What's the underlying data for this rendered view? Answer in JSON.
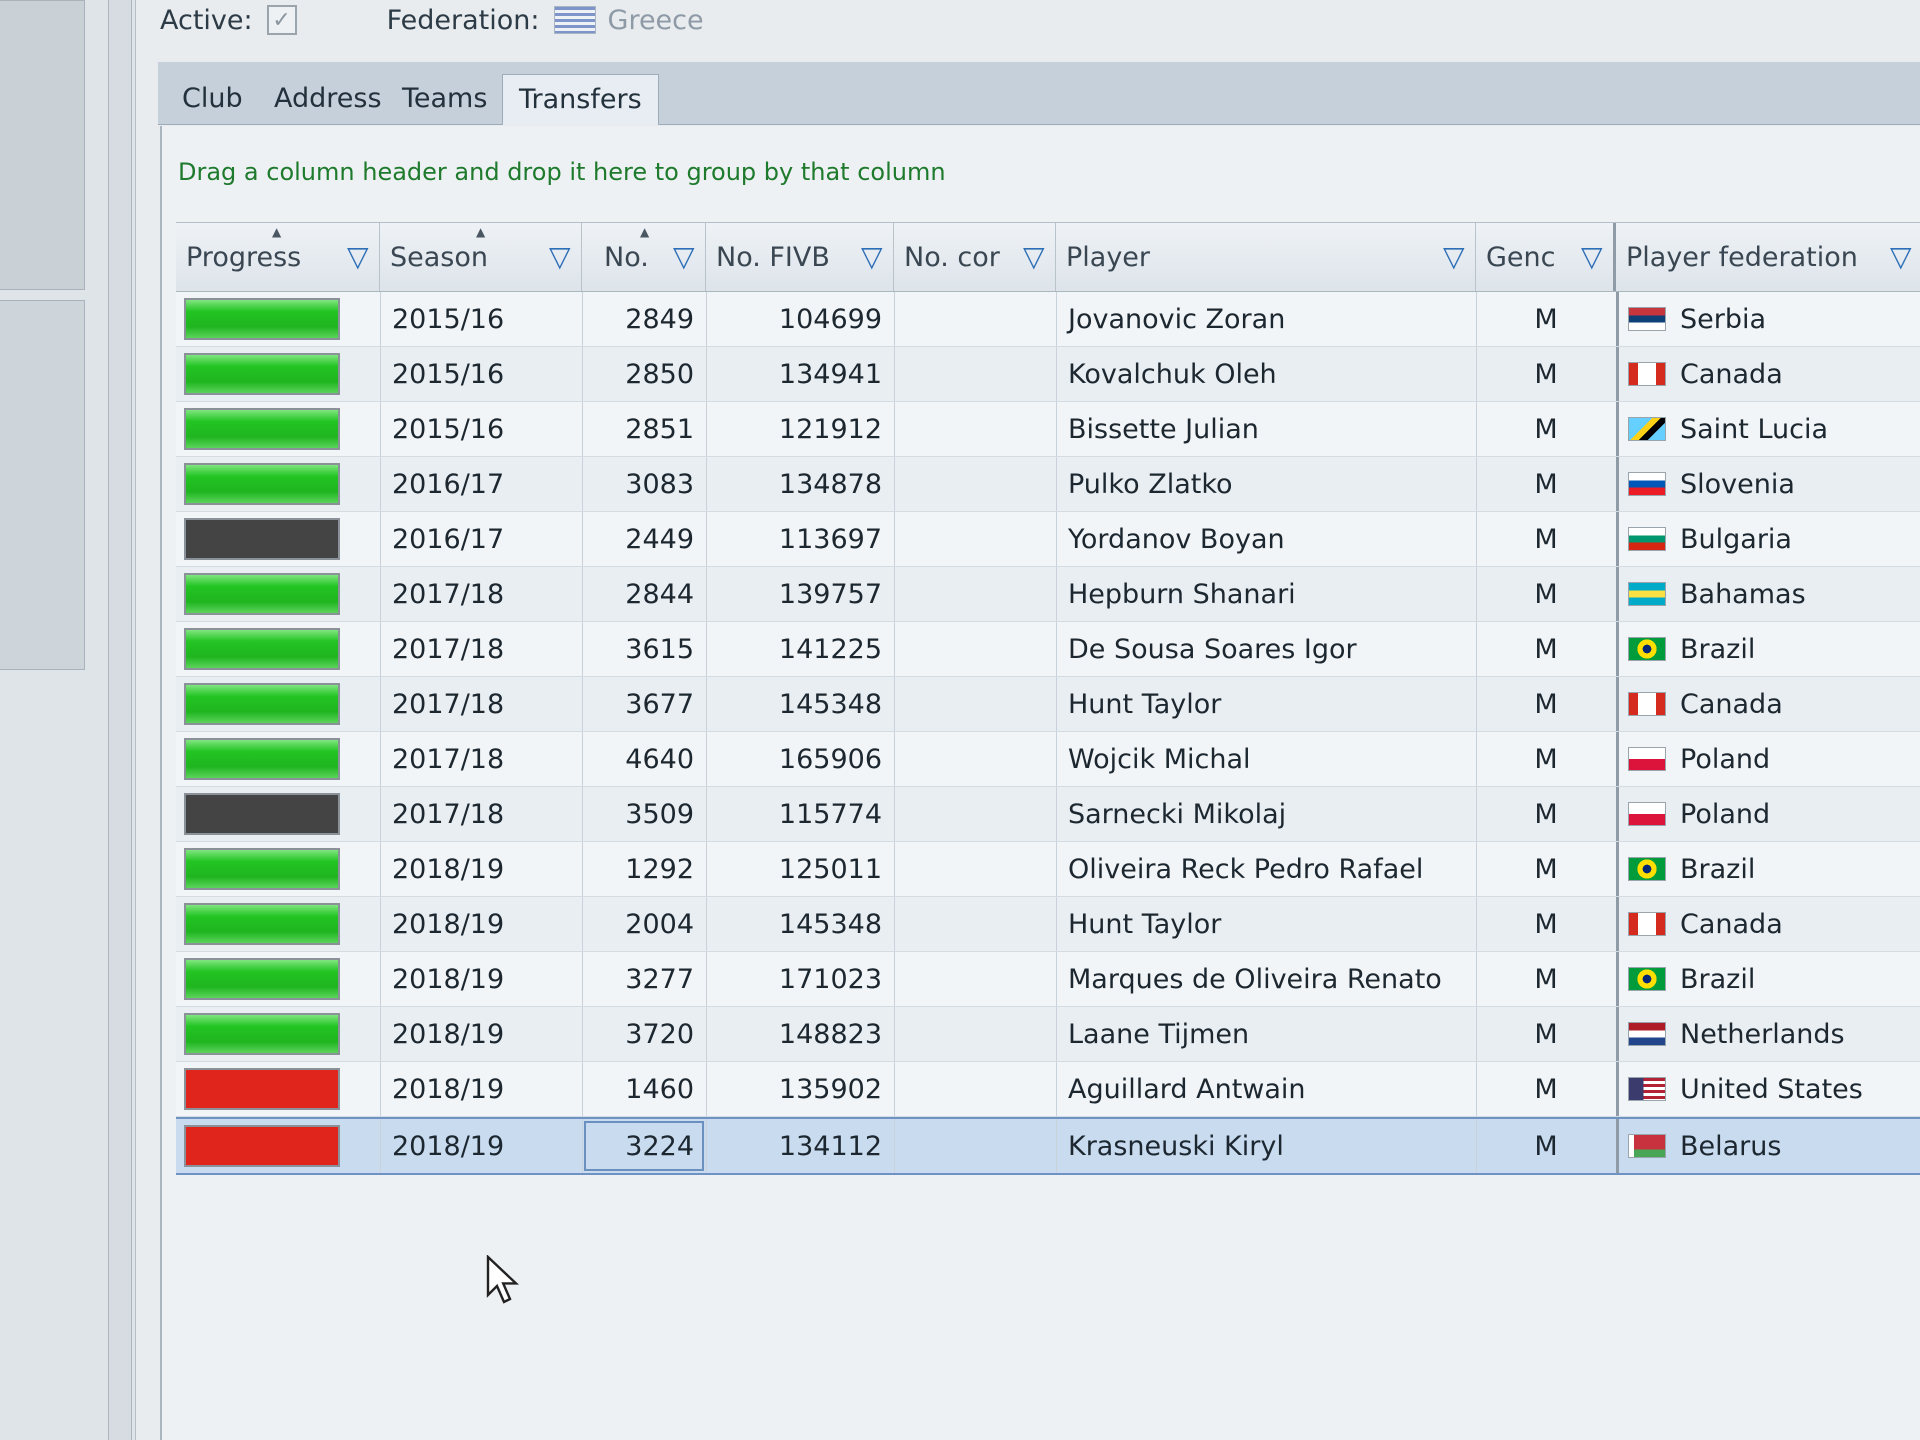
{
  "form": {
    "active_label": "Active:",
    "active_check": "✓",
    "federation_label": "Federation:",
    "federation_value": "Greece"
  },
  "tabs": [
    {
      "label": "Club"
    },
    {
      "label": "Address"
    },
    {
      "label": "Teams"
    },
    {
      "label": "Transfers"
    }
  ],
  "group_hint": "Drag a column header and drop it here to group by that column",
  "columns": {
    "progress": "Progress",
    "season": "Season",
    "no": "No.",
    "no_fivb": "No. FIVB",
    "no_con": "No. cor",
    "player": "Player",
    "gender": "Genc",
    "player_federation": "Player federation"
  },
  "filter_glyph": "▽",
  "rows": [
    {
      "progress": "green",
      "season": "2015/16",
      "no": "2849",
      "fivb": "104699",
      "player": "Jovanovic Zoran",
      "gender": "M",
      "federation": "Serbia",
      "flag": "serbia"
    },
    {
      "progress": "green",
      "season": "2015/16",
      "no": "2850",
      "fivb": "134941",
      "player": "Kovalchuk Oleh",
      "gender": "M",
      "federation": "Canada",
      "flag": "canada"
    },
    {
      "progress": "green",
      "season": "2015/16",
      "no": "2851",
      "fivb": "121912",
      "player": "Bissette Julian",
      "gender": "M",
      "federation": "Saint Lucia",
      "flag": "saint-lucia"
    },
    {
      "progress": "green",
      "season": "2016/17",
      "no": "3083",
      "fivb": "134878",
      "player": "Pulko Zlatko",
      "gender": "M",
      "federation": "Slovenia",
      "flag": "slovenia"
    },
    {
      "progress": "dark",
      "season": "2016/17",
      "no": "2449",
      "fivb": "113697",
      "player": "Yordanov Boyan",
      "gender": "M",
      "federation": "Bulgaria",
      "flag": "bulgaria"
    },
    {
      "progress": "green",
      "season": "2017/18",
      "no": "2844",
      "fivb": "139757",
      "player": "Hepburn Shanari",
      "gender": "M",
      "federation": "Bahamas",
      "flag": "bahamas"
    },
    {
      "progress": "green",
      "season": "2017/18",
      "no": "3615",
      "fivb": "141225",
      "player": "De Sousa Soares Igor",
      "gender": "M",
      "federation": "Brazil",
      "flag": "brazil"
    },
    {
      "progress": "green",
      "season": "2017/18",
      "no": "3677",
      "fivb": "145348",
      "player": "Hunt Taylor",
      "gender": "M",
      "federation": "Canada",
      "flag": "canada"
    },
    {
      "progress": "green",
      "season": "2017/18",
      "no": "4640",
      "fivb": "165906",
      "player": "Wojcik Michal",
      "gender": "M",
      "federation": "Poland",
      "flag": "poland"
    },
    {
      "progress": "dark",
      "season": "2017/18",
      "no": "3509",
      "fivb": "115774",
      "player": "Sarnecki Mikolaj",
      "gender": "M",
      "federation": "Poland",
      "flag": "poland"
    },
    {
      "progress": "green",
      "season": "2018/19",
      "no": "1292",
      "fivb": "125011",
      "player": "Oliveira Reck Pedro Rafael",
      "gender": "M",
      "federation": "Brazil",
      "flag": "brazil"
    },
    {
      "progress": "green",
      "season": "2018/19",
      "no": "2004",
      "fivb": "145348",
      "player": "Hunt Taylor",
      "gender": "M",
      "federation": "Canada",
      "flag": "canada"
    },
    {
      "progress": "green",
      "season": "2018/19",
      "no": "3277",
      "fivb": "171023",
      "player": "Marques de Oliveira Renato",
      "gender": "M",
      "federation": "Brazil",
      "flag": "brazil"
    },
    {
      "progress": "green",
      "season": "2018/19",
      "no": "3720",
      "fivb": "148823",
      "player": "Laane Tijmen",
      "gender": "M",
      "federation": "Netherlands",
      "flag": "netherlands"
    },
    {
      "progress": "red",
      "season": "2018/19",
      "no": "1460",
      "fivb": "135902",
      "player": "Aguillard Antwain",
      "gender": "M",
      "federation": "United States",
      "flag": "united-states"
    },
    {
      "progress": "red",
      "season": "2018/19",
      "no": "3224",
      "fivb": "134112",
      "player": "Krasneuski Kiryl",
      "gender": "M",
      "federation": "Belarus",
      "flag": "belarus",
      "selected": true
    }
  ],
  "colors": {
    "progress_green": "#22c022",
    "progress_red": "#e0251d",
    "progress_dark": "#444444",
    "filter_icon": "#2c6fb7",
    "group_hint": "#1e7a2c"
  }
}
